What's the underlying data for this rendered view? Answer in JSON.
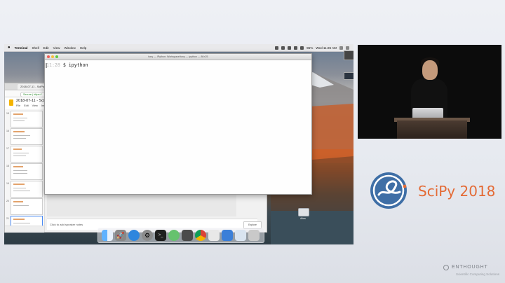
{
  "menubar": {
    "items": [
      "Terminal",
      "Shell",
      "Edit",
      "View",
      "Window",
      "Help"
    ],
    "battery": "96%",
    "clock": "Wed 11:26 AM"
  },
  "slides": {
    "tab_title": "2018-07-11 - SciPy",
    "address": "Secure | https://",
    "doc_title": "2018-07-11 - SciPy",
    "doc_menu": [
      "File",
      "Edit",
      "View",
      "Ins"
    ],
    "thumb_numbers": [
      "15",
      "16",
      "17",
      "18",
      "19",
      "20",
      "21"
    ],
    "speaker_notes_placeholder": "Click to add speaker notes",
    "explore_label": "Explore"
  },
  "terminal": {
    "title": "tony — IPython: Workspace/tony — ipython — 80×25",
    "time": "11:28",
    "command": "$ ipython"
  },
  "desktop": {
    "hd_label": "Aries"
  },
  "dock": {
    "icons": [
      "finder-icon",
      "launchpad-icon",
      "safari-icon",
      "system-preferences-icon",
      "terminal-icon",
      "atom-icon",
      "sublime-icon",
      "chrome-icon",
      "folder-icon",
      "documents-icon",
      "downloads-icon",
      "trash-icon"
    ]
  },
  "branding": {
    "conference": "SciPy 2018",
    "sponsor": "ENTHOUGHT",
    "sponsor_sub": "Scientific Computing Solutions"
  },
  "colors": {
    "scipy_blue": "#3f6fa6",
    "scipy_orange": "#e46a35"
  }
}
